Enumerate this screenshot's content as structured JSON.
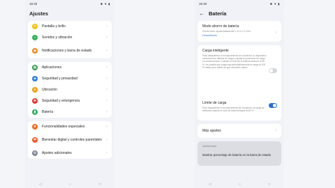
{
  "left": {
    "status": {
      "time": "16:40",
      "icons": "✱ ▼ ▮"
    },
    "title": "Ajustes",
    "groups": [
      [
        {
          "label": "Pantalla y brillo",
          "icon": "sun-icon",
          "color": "#f5c20f",
          "glyph": "☀"
        },
        {
          "label": "Sonidos y vibración",
          "icon": "speaker-icon",
          "color": "#38b35c",
          "glyph": "♪"
        },
        {
          "label": "Notificaciones y barra de estado",
          "icon": "bell-icon",
          "color": "#f28b1e",
          "glyph": "◆"
        }
      ],
      [
        {
          "label": "Aplicaciones",
          "icon": "apps-icon",
          "color": "#2e9a45",
          "glyph": "▦"
        },
        {
          "label": "Seguridad y privacidad",
          "icon": "shield-icon",
          "color": "#2f7de0",
          "glyph": "◈"
        },
        {
          "label": "Ubicación",
          "icon": "location-icon",
          "color": "#f0a215",
          "glyph": "●"
        },
        {
          "label": "Seguridad y emergencia",
          "icon": "sos-icon",
          "color": "#e53935",
          "glyph": "✚"
        },
        {
          "label": "Batería",
          "icon": "battery-icon",
          "color": "#2eae5a",
          "glyph": "▮"
        }
      ],
      [
        {
          "label": "Funcionalidades especiales",
          "icon": "star-icon",
          "color": "#f06a1e",
          "glyph": "★"
        },
        {
          "label": "Bienestar digital y controles parentales",
          "icon": "wellbeing-icon",
          "color": "#f35a23",
          "glyph": "❤"
        },
        {
          "label": "Ajustes adicionales",
          "icon": "gear-icon",
          "color": "#7e8596",
          "glyph": "⚙"
        }
      ]
    ]
  },
  "right": {
    "status": {
      "time": "16:40",
      "icons": "✱ ▼ ▮"
    },
    "back": "←",
    "title": "Batería",
    "power_saving": {
      "name": "Modo ahorro de batería",
      "desc": "Puede durar aproximadamente 1 d 11 h 27 min",
      "state": "Desactivado"
    },
    "smart_charge": {
      "name": "Carga inteligente",
      "desc": "Para desacelerar el envejecimiento de la batería, tu dispositivo memoriza tus hábitos de carga y ajusta los patrones de carga en consecuencia. Cuando el nivel de la batería alcance el 80 %, es posible que posponga automáticamente la carga al 100 % hasta poco antes de que necesites usarlo",
      "enabled": false
    },
    "charge_limit": {
      "name": "Límite de carga",
      "desc": "Para desacelerar el envejecimiento de la batería, la carga se detendrá cuando el nivel de batería llegue al 80 %",
      "enabled": true
    },
    "more": {
      "name": "Más ajustes"
    },
    "suggestion": {
      "hint": "Quizás busca",
      "text": "Mostrar porcentaje de batería en la barra de estado"
    }
  },
  "nav": {
    "back": "◁",
    "home": "○",
    "recent": "□"
  }
}
